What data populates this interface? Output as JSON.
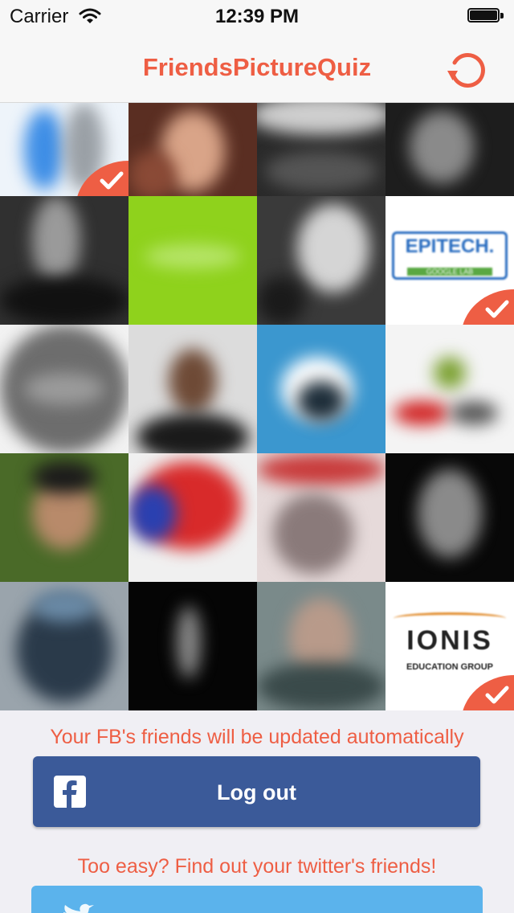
{
  "status_bar": {
    "carrier": "Carrier",
    "time": "12:39 PM"
  },
  "nav": {
    "title": "FriendsPictureQuiz",
    "refresh_icon": "refresh-icon"
  },
  "grid": {
    "columns": 4,
    "rows": 5,
    "cells": [
      {
        "theme": "light",
        "checked": true
      },
      {
        "theme": "warm",
        "checked": false
      },
      {
        "theme": "dark-building",
        "checked": false
      },
      {
        "theme": "dark",
        "checked": false
      },
      {
        "theme": "gray-dark",
        "checked": false
      },
      {
        "theme": "lime",
        "checked": false
      },
      {
        "theme": "gray-portrait",
        "checked": false
      },
      {
        "theme": "logo-epitech",
        "logo_text": "EPITECH.",
        "logo_sub": "GOOGLE LAB",
        "checked": true
      },
      {
        "theme": "gray-app",
        "checked": false
      },
      {
        "theme": "portrait-dark",
        "checked": false
      },
      {
        "theme": "blue-logo",
        "checked": false
      },
      {
        "theme": "white-android",
        "checked": false
      },
      {
        "theme": "green-portrait",
        "checked": false
      },
      {
        "theme": "red-blue",
        "checked": false
      },
      {
        "theme": "magazine",
        "checked": false
      },
      {
        "theme": "black-portrait",
        "checked": false
      },
      {
        "theme": "gray-helmet",
        "checked": false
      },
      {
        "theme": "black",
        "checked": false
      },
      {
        "theme": "gray-blur",
        "checked": false
      },
      {
        "theme": "logo-ionis",
        "logo_text": "IONIS",
        "logo_sub": "EDUCATION GROUP",
        "checked": true
      }
    ]
  },
  "footer": {
    "notice": "Your FB's friends will be updated automatically",
    "logout_label": "Log out",
    "twitter_prompt": "Too easy? Find out your twitter's friends!"
  },
  "colors": {
    "accent": "#ee5e44",
    "facebook": "#3b5a99",
    "twitter": "#5bb3ec"
  }
}
